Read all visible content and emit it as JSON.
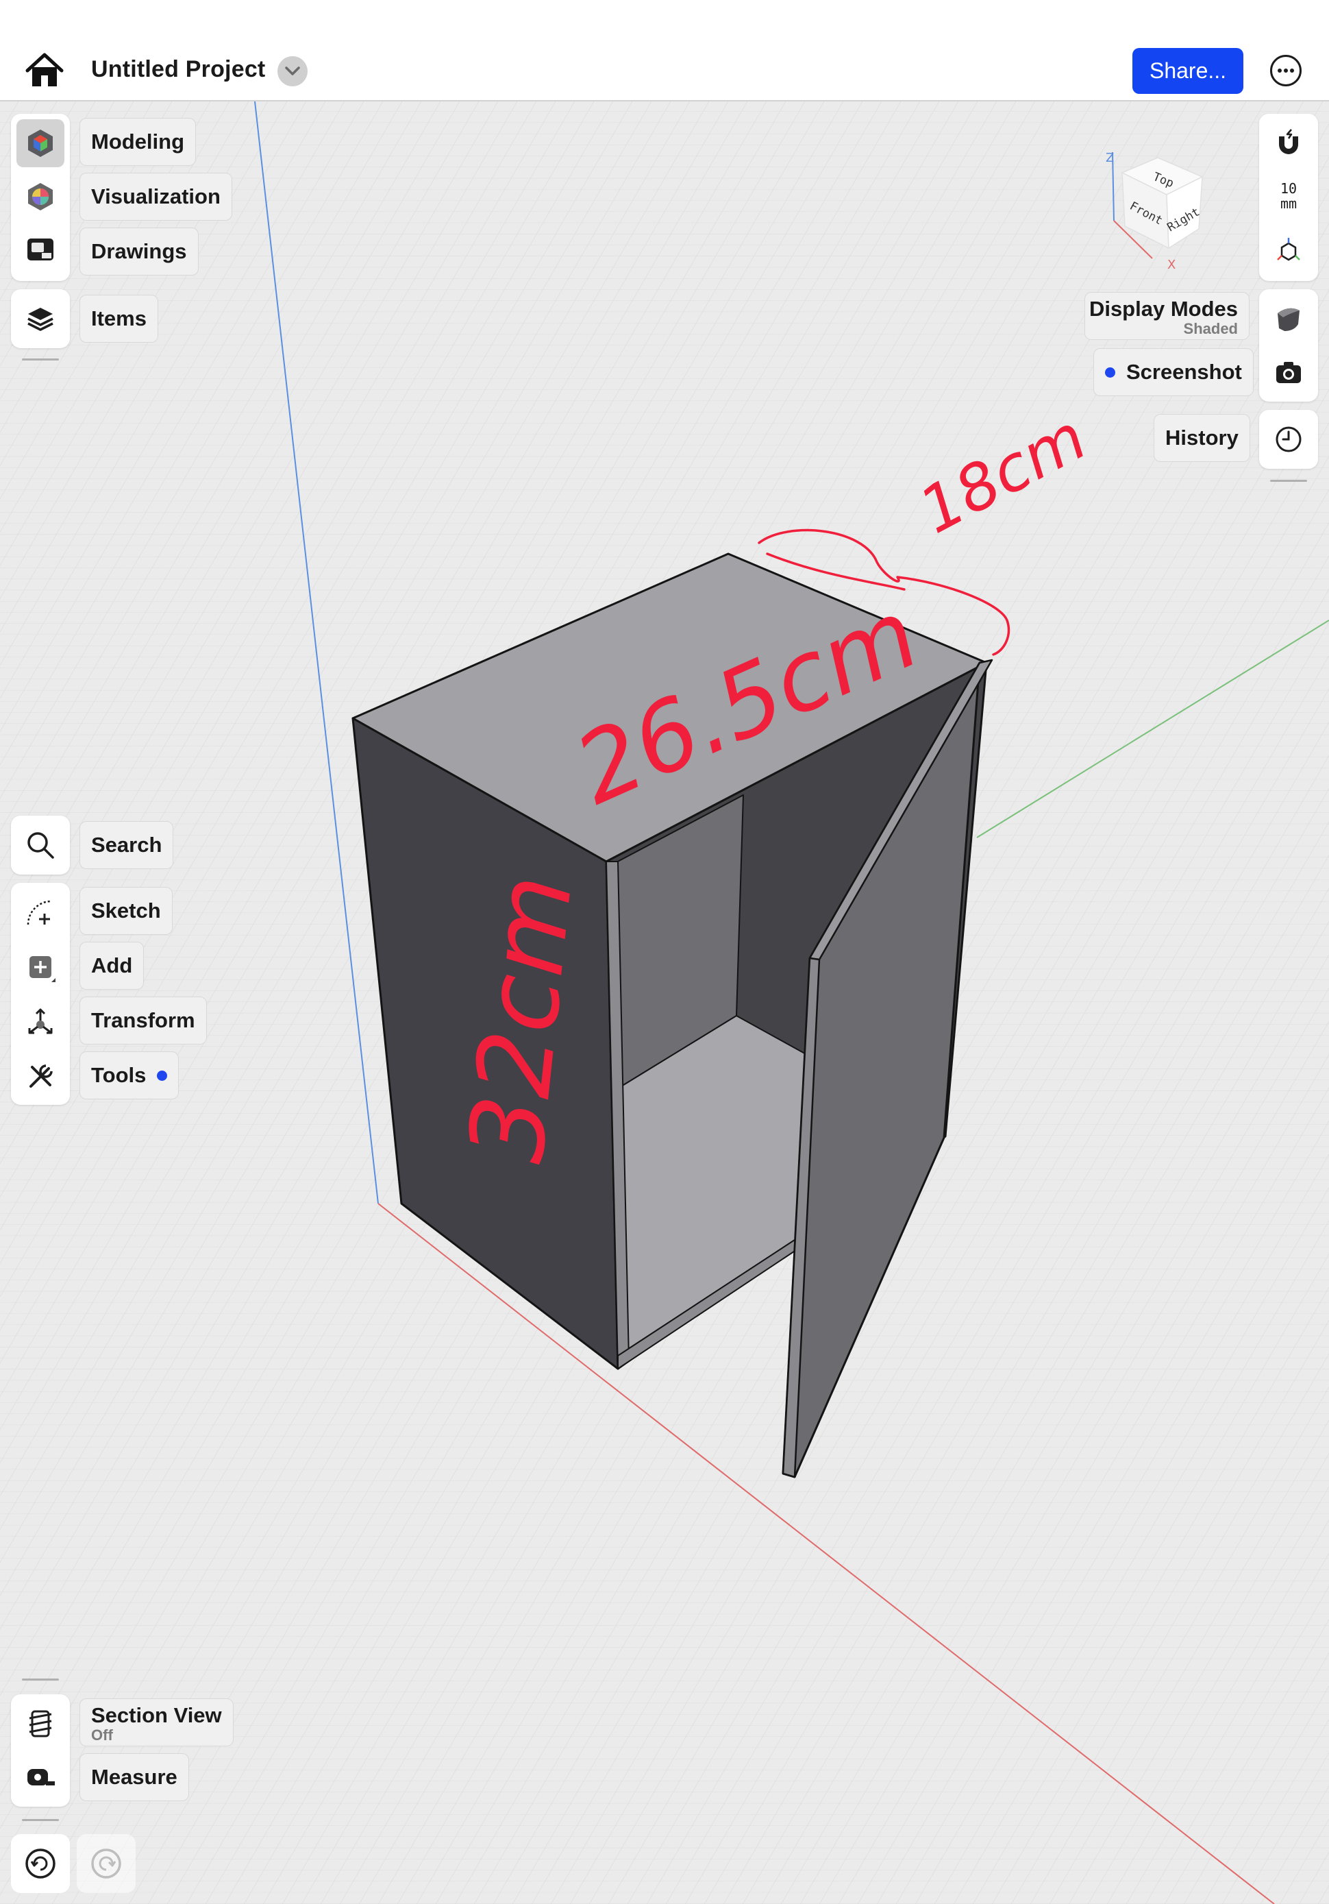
{
  "header": {
    "project_title": "Untitled Project",
    "share_label": "Share..."
  },
  "left_toolbar": {
    "workspaces": [
      {
        "label": "Modeling"
      },
      {
        "label": "Visualization"
      },
      {
        "label": "Drawings"
      }
    ],
    "items_label": "Items",
    "tools": [
      {
        "label": "Search"
      },
      {
        "label": "Sketch"
      },
      {
        "label": "Add"
      },
      {
        "label": "Transform"
      },
      {
        "label": "Tools"
      }
    ],
    "section_view": {
      "label": "Section View",
      "state": "Off"
    },
    "measure_label": "Measure"
  },
  "right_toolbar": {
    "grid_step": {
      "value": "10",
      "unit": "mm"
    },
    "display_modes": {
      "label": "Display Modes",
      "state": "Shaded"
    },
    "screenshot_label": "Screenshot",
    "history_label": "History"
  },
  "nav_cube": {
    "top": "Top",
    "front": "Front",
    "right": "Right",
    "axis_z": "Z",
    "axis_x": "X"
  },
  "annotations": {
    "depth": "18cm",
    "width": "26.5cm",
    "height": "32cm",
    "color": "#f0203c"
  },
  "colors": {
    "accent": "#1346f2",
    "axis_x": "#e06a6a",
    "axis_y": "#7ac07a",
    "axis_z": "#5b8fe0"
  }
}
